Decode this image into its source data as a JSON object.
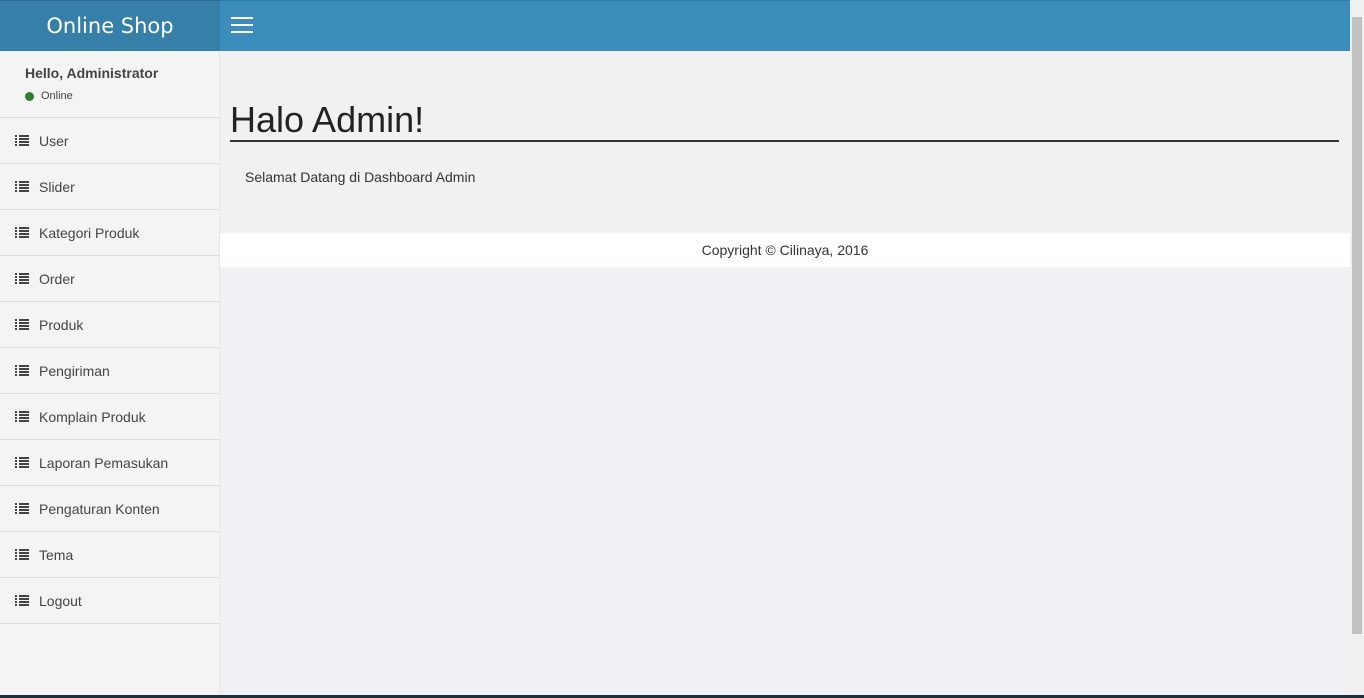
{
  "header": {
    "logo_text": "Online Shop",
    "menu_toggle_icon": "hamburger-icon"
  },
  "user_panel": {
    "greeting": "Hello, Administrator",
    "status": "Online",
    "status_color": "#2e7d32"
  },
  "sidebar": {
    "items": [
      {
        "label": "User",
        "icon": "list-icon"
      },
      {
        "label": "Slider",
        "icon": "list-icon"
      },
      {
        "label": "Kategori Produk",
        "icon": "list-icon"
      },
      {
        "label": "Order",
        "icon": "list-icon"
      },
      {
        "label": "Produk",
        "icon": "list-icon"
      },
      {
        "label": "Pengiriman",
        "icon": "list-icon"
      },
      {
        "label": "Komplain Produk",
        "icon": "list-icon"
      },
      {
        "label": "Laporan Pemasukan",
        "icon": "list-icon"
      },
      {
        "label": "Pengaturan Konten",
        "icon": "list-icon"
      },
      {
        "label": "Tema",
        "icon": "list-icon"
      },
      {
        "label": "Logout",
        "icon": "list-icon"
      }
    ]
  },
  "main": {
    "title": "Halo Admin!",
    "welcome_text": "Selamat Datang di Dashboard Admin"
  },
  "footer": {
    "copyright": "Copyright © Cilinaya, 2016"
  },
  "colors": {
    "navbar": "#3c8dbc",
    "logo_bg": "#367fa9"
  }
}
